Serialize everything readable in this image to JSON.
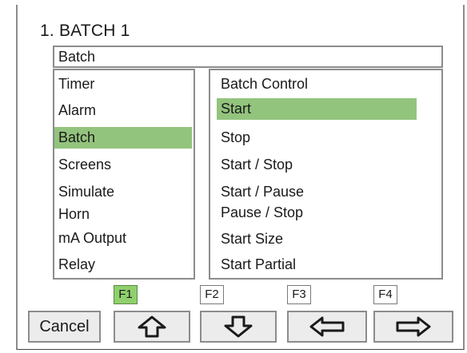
{
  "screen": {
    "title": "1. BATCH 1",
    "menu_path": "Batch"
  },
  "left_menu": {
    "items": [
      {
        "label": "Timer",
        "selected": false
      },
      {
        "label": "Alarm",
        "selected": false
      },
      {
        "label": "Batch",
        "selected": true
      },
      {
        "label": "Screens",
        "selected": false
      },
      {
        "label": "Simulate",
        "selected": false
      },
      {
        "label": "Horn",
        "selected": false
      },
      {
        "label": "mA Output",
        "selected": false
      },
      {
        "label": "Relay",
        "selected": false
      }
    ]
  },
  "right_menu": {
    "items": [
      {
        "label": "Batch Control",
        "selected": false
      },
      {
        "label": "Start",
        "selected": true
      },
      {
        "label": "Stop",
        "selected": false
      },
      {
        "label": "Start / Stop",
        "selected": false
      },
      {
        "label": "Start / Pause",
        "selected": false
      },
      {
        "label": "Pause / Stop",
        "selected": false
      },
      {
        "label": "Start Size",
        "selected": false
      },
      {
        "label": "Start Partial",
        "selected": false
      }
    ]
  },
  "function_keys": [
    {
      "label": "F1",
      "active": true
    },
    {
      "label": "F2",
      "active": false
    },
    {
      "label": "F3",
      "active": false
    },
    {
      "label": "F4",
      "active": false
    }
  ],
  "buttons": {
    "cancel": "Cancel",
    "up_icon": "arrow-up-icon",
    "down_icon": "arrow-down-icon",
    "left_icon": "arrow-left-icon",
    "right_icon": "arrow-right-icon"
  },
  "colors": {
    "selection": "#93c47d",
    "active_key": "#8fd06d"
  }
}
